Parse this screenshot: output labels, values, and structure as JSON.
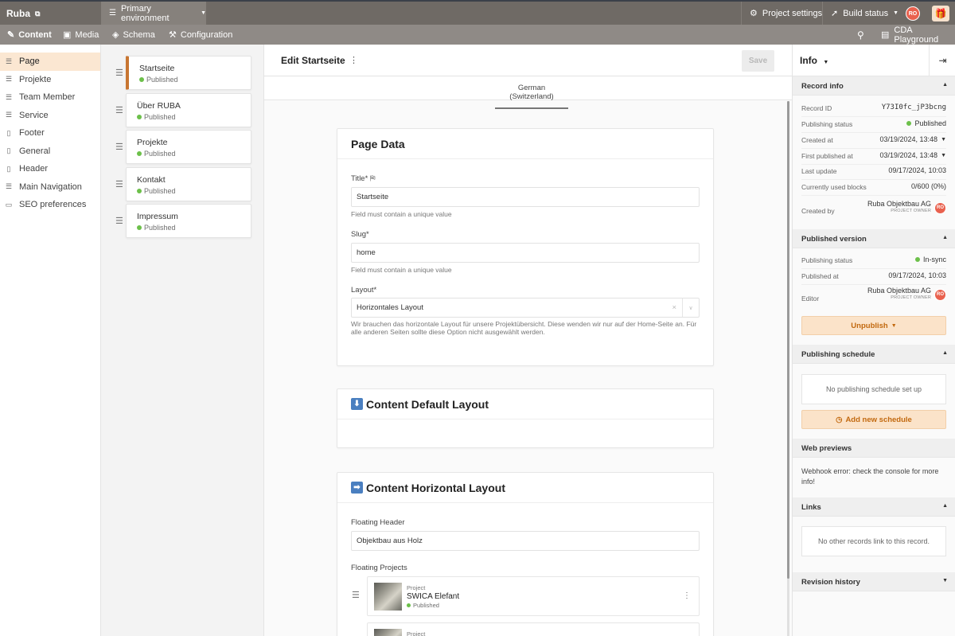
{
  "topbar": {
    "brand": "Ruba",
    "environment": "Primary environment",
    "project_settings": "Project settings",
    "build_status": "Build status",
    "avatar_initials": "RO"
  },
  "navbar": {
    "tabs": [
      {
        "label": "Content",
        "icon": "pencil-square-icon",
        "active": true
      },
      {
        "label": "Media",
        "icon": "image-icon",
        "active": false
      },
      {
        "label": "Schema",
        "icon": "layers-icon",
        "active": false
      },
      {
        "label": "Configuration",
        "icon": "sliders-icon",
        "active": false
      }
    ],
    "cda_playground": "CDA Playground"
  },
  "sidebar": {
    "items": [
      {
        "label": "Page",
        "icon": "list-icon",
        "active": true
      },
      {
        "label": "Projekte",
        "icon": "list-icon"
      },
      {
        "label": "Team Member",
        "icon": "list-icon"
      },
      {
        "label": "Service",
        "icon": "list-icon"
      },
      {
        "label": "Footer",
        "icon": "document-icon"
      },
      {
        "label": "General",
        "icon": "document-icon"
      },
      {
        "label": "Header",
        "icon": "document-icon"
      },
      {
        "label": "Main Navigation",
        "icon": "list-icon"
      },
      {
        "label": "SEO preferences",
        "icon": "briefcase-icon"
      }
    ]
  },
  "records": [
    {
      "name": "Startseite",
      "status": "Published",
      "active": true
    },
    {
      "name": "Über RUBA",
      "status": "Published"
    },
    {
      "name": "Projekte",
      "status": "Published"
    },
    {
      "name": "Kontakt",
      "status": "Published"
    },
    {
      "name": "Impressum",
      "status": "Published"
    }
  ],
  "editor": {
    "title": "Edit Startseite",
    "save_label": "Save",
    "locale_tab": "German (Switzerland)",
    "page_data": {
      "heading": "Page Data",
      "title_label": "Title*",
      "title_value": "Startseite",
      "title_hint": "Field must contain a unique value",
      "slug_label": "Slug*",
      "slug_value": "home",
      "slug_hint": "Field must contain a unique value",
      "layout_label": "Layout*",
      "layout_value": "Horizontales Layout",
      "layout_hint": "Wir brauchen das horizontale Layout für unsere Projektübersicht. Diese wenden wir nur auf der Home-Seite an. Für alle anderen Seiten sollte diese Option nicht ausgewählt werden."
    },
    "default_layout": {
      "heading": "Content Default Layout",
      "emoji": "⬇"
    },
    "horizontal_layout": {
      "heading": "Content Horizontal Layout",
      "emoji": "➡",
      "floating_header_label": "Floating Header",
      "floating_header_value": "Objektbau aus Holz",
      "floating_projects_label": "Floating Projects",
      "projects": [
        {
          "type": "Project",
          "name": "SWICA Elefant",
          "status": "Published"
        },
        {
          "type": "Project",
          "name": "",
          "status": ""
        }
      ]
    }
  },
  "info": {
    "title": "Info",
    "record_info": {
      "heading": "Record info",
      "record_id_label": "Record ID",
      "record_id": "Y73I0fc_jP3bcng",
      "publishing_status_label": "Publishing status",
      "publishing_status": "Published",
      "created_at_label": "Created at",
      "created_at": "03/19/2024, 13:48",
      "first_published_label": "First published at",
      "first_published": "03/19/2024, 13:48",
      "last_update_label": "Last update",
      "last_update": "09/17/2024, 10:03",
      "blocks_label": "Currently used blocks",
      "blocks": "0/600 (0%)",
      "created_by_label": "Created by",
      "created_by": "Ruba Objektbau AG",
      "created_by_role": "PROJECT OWNER"
    },
    "published_version": {
      "heading": "Published version",
      "status_label": "Publishing status",
      "status": "In-sync",
      "published_at_label": "Published at",
      "published_at": "09/17/2024, 10:03",
      "editor_label": "Editor",
      "editor": "Ruba Objektbau AG",
      "editor_role": "PROJECT OWNER",
      "unpublish_label": "Unpublish"
    },
    "schedule": {
      "heading": "Publishing schedule",
      "empty": "No publishing schedule set up",
      "add_label": "Add new schedule"
    },
    "web_previews": {
      "heading": "Web previews",
      "text": "Webhook error: check the console for more info!"
    },
    "links": {
      "heading": "Links",
      "empty": "No other records link to this record."
    },
    "revision_history": {
      "heading": "Revision history"
    }
  },
  "colors": {
    "accent": "#c87531",
    "published": "#6cc04a",
    "avatar": "#e9614e",
    "topbar": "#6f6a65"
  }
}
